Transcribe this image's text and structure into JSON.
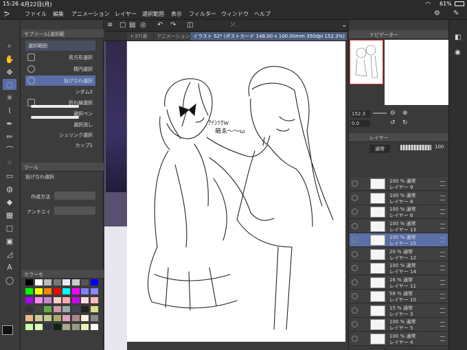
{
  "status_bar": {
    "time": "15:26",
    "date": "4月22日(月)",
    "battery": "61%"
  },
  "menu": {
    "items": [
      "ファイル",
      "編集",
      "アニメーション",
      "レイヤー",
      "選択範囲",
      "表示",
      "フィルター",
      "ウィンドウ",
      "ヘルプ"
    ]
  },
  "subtool_panel": {
    "title": "サブツール[選択範",
    "items": [
      "選択範囲",
      "長方形選択",
      "楕円選択",
      "投げなわ選択",
      "折れ線選択",
      "選択ペン",
      "選択消し",
      "シュリンク選択"
    ],
    "extra": [
      "ンダム2",
      "カップ1"
    ],
    "selected_index": 3
  },
  "tool_property": {
    "title": "ツール",
    "tool_name": "投げなわ選択",
    "creation_label": "作成方法",
    "antialias_label": "アンチエイ"
  },
  "color_panel": {
    "title": "カラーセ"
  },
  "canvas_tabs": [
    "ト37(表",
    "アニメーション",
    "イラスト 52* (ポストカード 148.00 x 100.00mm 350dpi 152.3%)"
  ],
  "canvas_tab_active": 2,
  "canvas_text": {
    "note1": "ｱｲｼﾂｸw",
    "note2": "萌ゑ〜〜ω"
  },
  "navigator": {
    "title": "ナビゲーター",
    "zoom": "152.3",
    "angle": "0.0"
  },
  "layer_panel": {
    "title": "レイヤー",
    "blend_mode": "通常",
    "opacity": "100",
    "layers": [
      {
        "pct": "100 %  通常",
        "name": "レイヤー 9"
      },
      {
        "pct": "100 %  通常",
        "name": "レイヤー 8"
      },
      {
        "pct": "100 %  通常",
        "name": "レイヤー 6"
      },
      {
        "pct": "100 %  通常",
        "name": "レイヤー 13"
      },
      {
        "pct": "100 %  通常",
        "name": "レイヤー 15"
      },
      {
        "pct": "20 %  通常",
        "name": "レイヤー 12"
      },
      {
        "pct": "100 %  通常",
        "name": "レイヤー 14"
      },
      {
        "pct": "16 %  通常",
        "name": "レイヤー 11"
      },
      {
        "pct": "58 %  通常",
        "name": "レイヤー 10"
      },
      {
        "pct": "15 %  通常",
        "name": "レイヤー 3"
      },
      {
        "pct": "100 %  通常",
        "name": "レイヤー 5"
      },
      {
        "pct": "100 %  通常",
        "name": "レイヤー 4"
      }
    ],
    "selected_index": 4
  },
  "colors": {
    "accent": "#5a6fa8",
    "selection_red": "#dd3333"
  }
}
